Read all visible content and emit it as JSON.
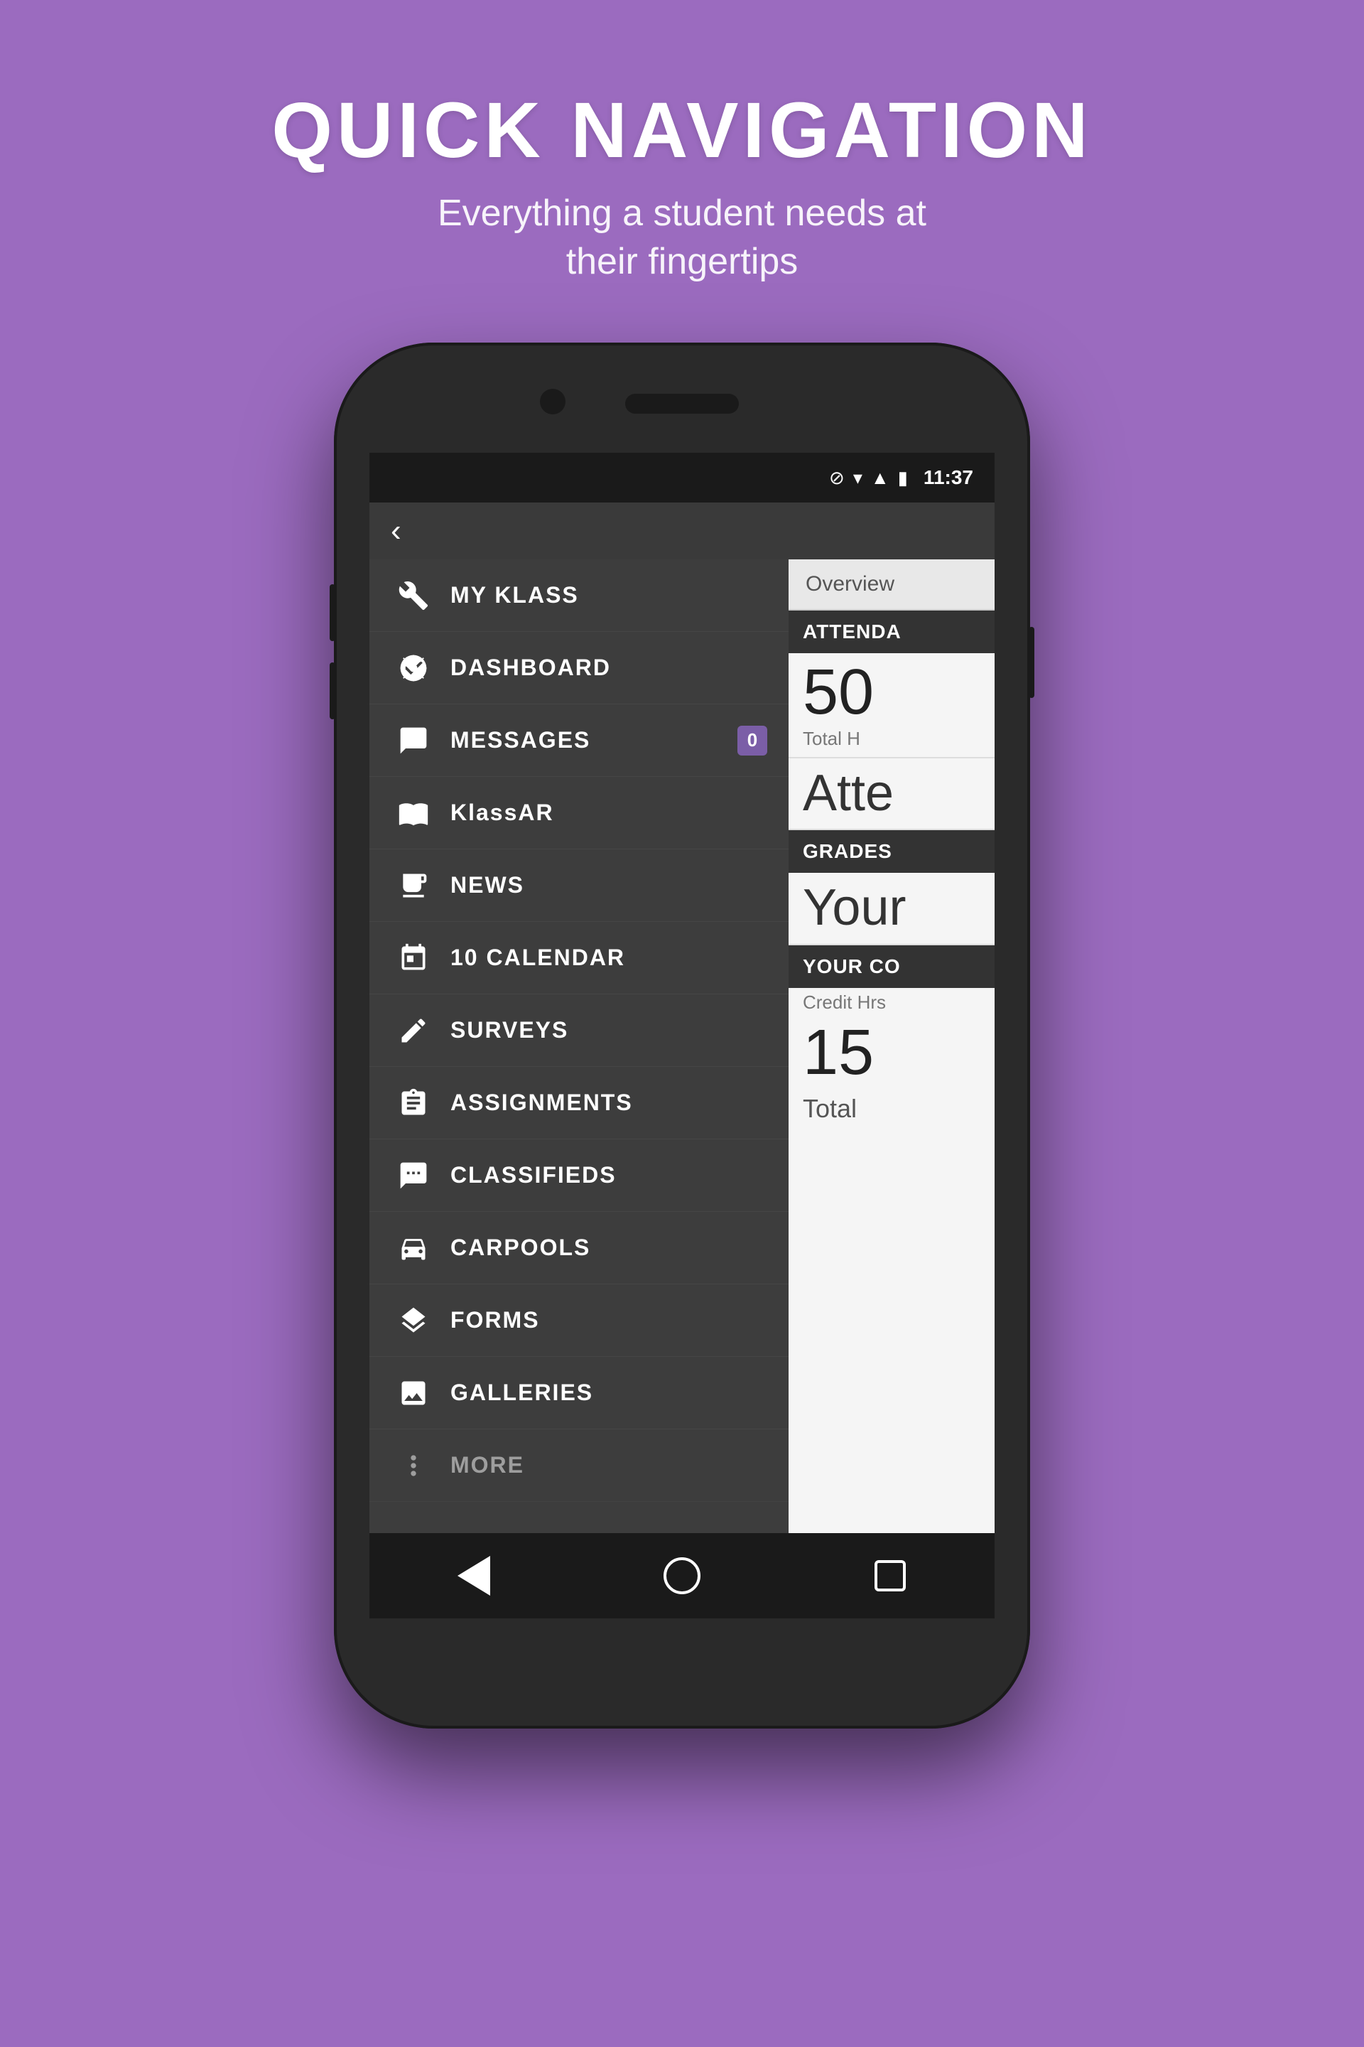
{
  "header": {
    "title": "QUICK NAVIGATION",
    "subtitle": "Everything a student needs at\ntheir fingertips"
  },
  "statusBar": {
    "time": "11:37",
    "icons": [
      "⊘",
      "▼",
      "▲",
      "🔋"
    ]
  },
  "topBar": {
    "backArrow": "‹"
  },
  "rightPanel": {
    "overviewTab": "Overview",
    "sections": [
      {
        "type": "header",
        "text": "ATTENDA"
      },
      {
        "type": "bigNumber",
        "value": "50",
        "label": "Total H"
      },
      {
        "type": "sectionText",
        "value": "Atte"
      },
      {
        "type": "header",
        "text": "GRADES"
      },
      {
        "type": "sectionText",
        "value": "Your"
      },
      {
        "type": "header",
        "text": "YOUR CO"
      },
      {
        "type": "creditLabel",
        "text": "Credit Hrs"
      },
      {
        "type": "creditNumber",
        "value": "15"
      },
      {
        "type": "totalLabel",
        "text": "Total"
      }
    ]
  },
  "navItems": [
    {
      "id": "my-klass",
      "label": "MY KLASS",
      "icon": "wrench-screwdriver",
      "badge": null
    },
    {
      "id": "dashboard",
      "label": "DASHBOARD",
      "icon": "dashboard",
      "badge": null
    },
    {
      "id": "messages",
      "label": "MESSAGES",
      "icon": "chat",
      "badge": "0"
    },
    {
      "id": "klassar",
      "label": "KlassAR",
      "icon": "book",
      "badge": null
    },
    {
      "id": "news",
      "label": "NEWS",
      "icon": "newspaper",
      "badge": null
    },
    {
      "id": "calendar",
      "label": "CALENDAR",
      "icon": "calendar",
      "badge": null
    },
    {
      "id": "surveys",
      "label": "SURVEYS",
      "icon": "pencil",
      "badge": null
    },
    {
      "id": "assignments",
      "label": "ASSIGNMENTS",
      "icon": "clipboard",
      "badge": null
    },
    {
      "id": "classifieds",
      "label": "CLASSIFIEDS",
      "icon": "classifieds",
      "badge": null
    },
    {
      "id": "carpools",
      "label": "CARPOOLS",
      "icon": "car",
      "badge": null
    },
    {
      "id": "forms",
      "label": "FORMS",
      "icon": "layers",
      "badge": null
    },
    {
      "id": "galleries",
      "label": "GALLERIES",
      "icon": "gallery",
      "badge": null
    },
    {
      "id": "more",
      "label": "MORE",
      "icon": "more",
      "badge": null
    }
  ],
  "bottomNav": {
    "back": "back",
    "home": "home",
    "recent": "recent"
  }
}
